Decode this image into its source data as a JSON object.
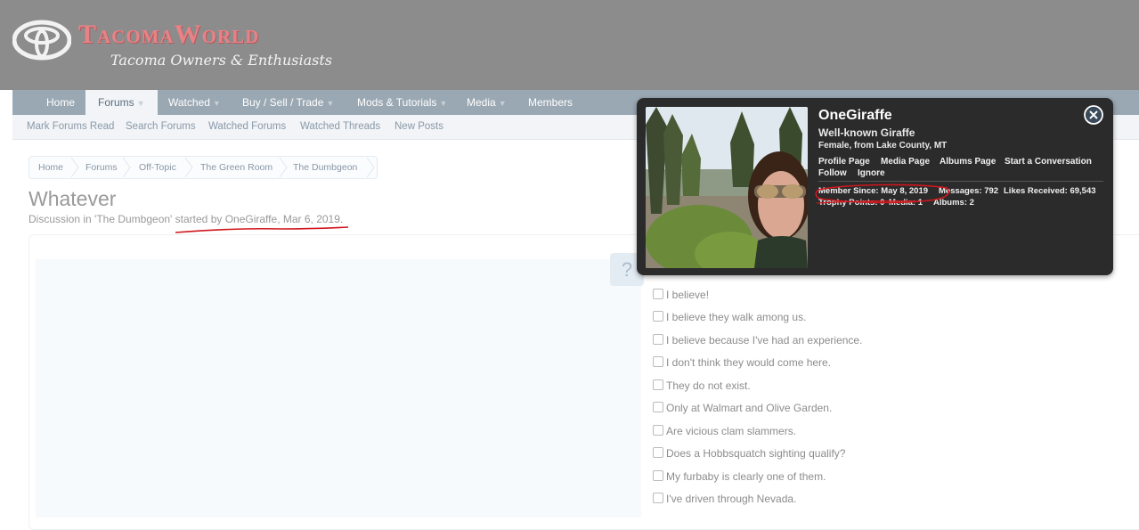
{
  "header": {
    "logo_title": "TacomaWorld",
    "logo_tagline": "Tacoma Owners & Enthusiasts"
  },
  "nav": {
    "tabs": [
      {
        "label": "Home",
        "dropdown": false
      },
      {
        "label": "Forums",
        "dropdown": true,
        "active": true
      },
      {
        "label": "Watched",
        "dropdown": true
      },
      {
        "label": "Buy / Sell / Trade",
        "dropdown": true
      },
      {
        "label": "Mods & Tutorials",
        "dropdown": true
      },
      {
        "label": "Media",
        "dropdown": true
      },
      {
        "label": "Members",
        "dropdown": false
      }
    ],
    "subnav": [
      "Mark Forums Read",
      "Search Forums",
      "Watched Forums",
      "Watched Threads",
      "New Posts"
    ]
  },
  "breadcrumb": [
    "Home",
    "Forums",
    "Off-Topic",
    "The Green Room",
    "The Dumbgeon"
  ],
  "thread": {
    "title": "Whatever",
    "byline_prefix": "Discussion in 'The Dumbgeon' ",
    "byline_started": "started by ",
    "byline_author": "OneGiraffe",
    "byline_sep": ", ",
    "byline_date": "Mar 6, 2019",
    "byline_end": "."
  },
  "help_icon": "?",
  "poll": {
    "options": [
      "I believe!",
      "I believe they walk among us.",
      "I believe because I've had an experience.",
      "I don't think they would come here.",
      "They do not exist.",
      "Only at Walmart and Olive Garden.",
      "Are vicious clam slammers.",
      "Does a Hobbsquatch sighting qualify?",
      "My furbaby is clearly one of them.",
      "I've driven through Nevada."
    ]
  },
  "member_card": {
    "name": "OneGiraffe",
    "user_title": "Well-known Giraffe",
    "info": "Female, from Lake County, MT",
    "links": [
      "Profile Page",
      "Media Page",
      "Albums Page",
      "Start a Conversation",
      "Follow",
      "Ignore"
    ],
    "stats_row1": [
      "Member Since: May 8, 2019",
      "Messages: 792",
      "Likes Received: 69,543"
    ],
    "stats_row2": [
      "Trophy Points: 0",
      "Media: 1",
      "Albums: 2"
    ]
  },
  "colors": {
    "header_bg": "#8c8c8c",
    "logo_red": "#e98286",
    "nav_bg": "#9aa8b3",
    "card_bg": "#2b2b2b",
    "annotation_red": "#d0161c"
  },
  "icons": [
    "toyota-emblem-icon",
    "help-icon",
    "close-icon",
    "checkbox-icon",
    "dropdown-arrow-icon"
  ]
}
